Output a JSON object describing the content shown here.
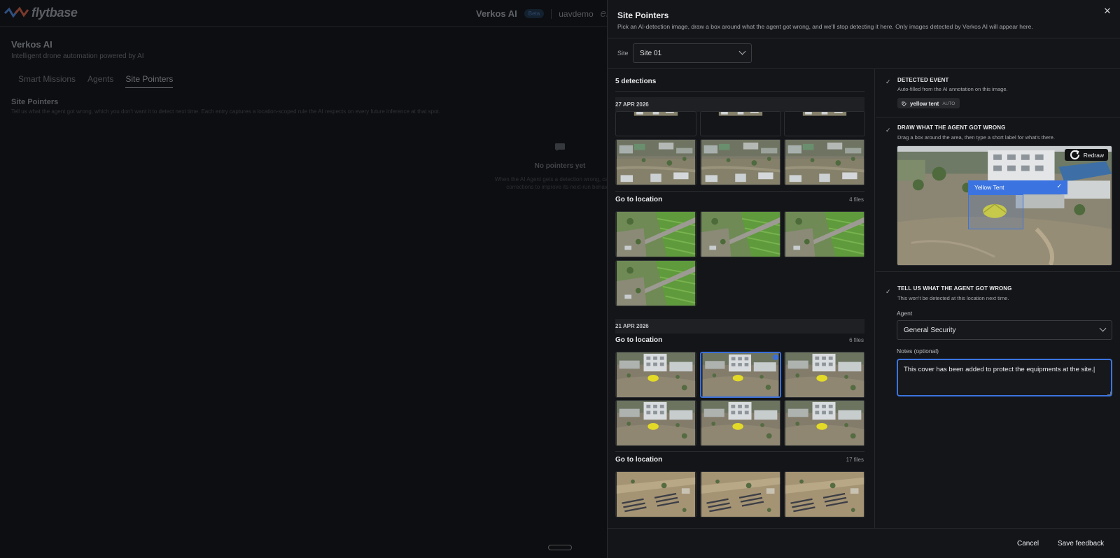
{
  "background": {
    "logo_text": "flytbase",
    "brand": "Verkos AI",
    "beta_badge": "Beta",
    "org": "uavdemo",
    "org_suffix": "ente",
    "page_title": "Verkos AI",
    "page_subtitle": "Intelligent drone automation powered by AI",
    "tabs": [
      {
        "label": "Smart Missions"
      },
      {
        "label": "Agents"
      },
      {
        "label": "Site Pointers"
      }
    ],
    "section_title": "Site Pointers",
    "section_desc": "Tell us what the agent got wrong, which you don't want it to detect next time. Each entry captures a location-scoped rule the AI respects on every future inference at that spot.",
    "empty_title": "No pointers yet",
    "empty_desc_1": "When the AI Agent gets a detection wrong, capture it",
    "empty_desc_2": "corrections to improve its next-run behavior"
  },
  "drawer": {
    "title": "Site Pointers",
    "subtitle": "Pick an AI-detection image, draw a box around what the agent got wrong, and we'll stop detecting it here. Only images detected by Verkos AI will appear here.",
    "site_label": "Site",
    "site_value": "Site 01",
    "detections_label": "5 detections",
    "groups": [
      {
        "date": "27 APR 2026"
      },
      {
        "title": "Go to location",
        "count": "4 files"
      },
      {
        "date": "21 APR 2026"
      },
      {
        "title": "Go to location",
        "count": "6 files"
      },
      {
        "title": "Go to location",
        "count": "17 files"
      }
    ],
    "step1": {
      "title": "DETECTED EVENT",
      "desc": "Auto-filled from the AI annotation on this image.",
      "tag": "yellow tent",
      "tag_badge": "AUTO"
    },
    "step2": {
      "title": "DRAW WHAT THE AGENT GOT WRONG",
      "desc": "Drag a box around the area, then type a short label for what's there.",
      "redraw_label": "Redraw",
      "box_label": "Yellow Tent"
    },
    "step3": {
      "title": "TELL US WHAT THE AGENT GOT WRONG",
      "desc": "This won't be detected at this location next time.",
      "agent_label": "Agent",
      "agent_value": "General Security",
      "notes_label": "Notes (optional)",
      "notes_value": "This cover has been added to protect the equipments at the site."
    },
    "footer": {
      "cancel_label": "Cancel",
      "save_label": "Save feedback"
    }
  },
  "icons": {
    "close": "close-icon",
    "chevron": "chevron-down-icon",
    "check": "check-icon",
    "tag": "tag-icon",
    "redraw": "redraw-icon",
    "chat": "chat-bubble-icon"
  },
  "colors": {
    "accent": "#3b74e0",
    "drawer_bg": "#141518",
    "tent_yellow": "#e5dc2a"
  }
}
